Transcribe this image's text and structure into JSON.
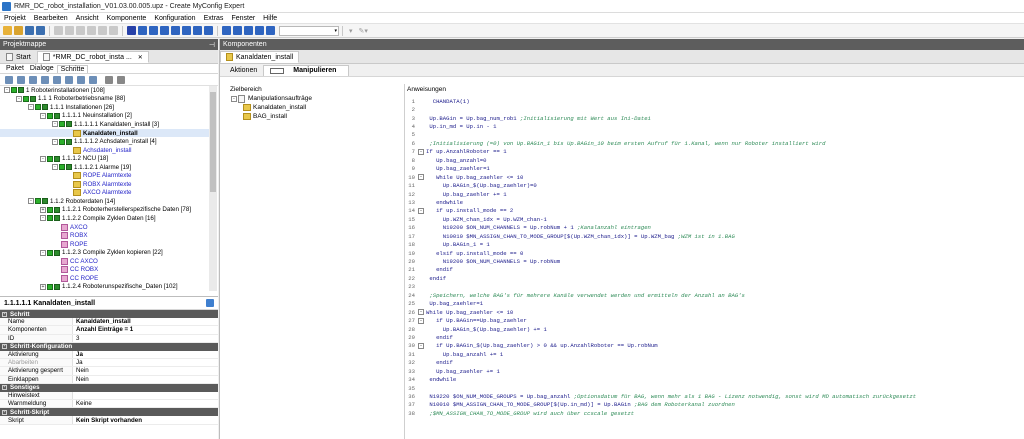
{
  "window": {
    "title": "RMR_DC_robot_installation_V01.03.00.005.upz - Create MyConfig Expert"
  },
  "menu": [
    "Projekt",
    "Bearbeiten",
    "Ansicht",
    "Komponente",
    "Konfiguration",
    "Extras",
    "Fenster",
    "Hilfe"
  ],
  "left": {
    "panel_title": "Projektmappe",
    "tabs": [
      {
        "label": "Start"
      },
      {
        "label": "*RMR_DC_robot_insta ..."
      }
    ],
    "subtabs": [
      "Paket",
      "Dialoge",
      "Schritte"
    ],
    "tree": [
      {
        "d": 0,
        "exp": "-",
        "cb": true,
        "icon": "fol",
        "text": "1 Roboterinstallationen [108]"
      },
      {
        "d": 1,
        "exp": "-",
        "cb": true,
        "icon": "fol",
        "text": "1.1 1 Roboterbetriebsname [88]"
      },
      {
        "d": 2,
        "exp": "-",
        "cb": true,
        "icon": "fol",
        "text": "1.1.1 Installationen [26]"
      },
      {
        "d": 3,
        "exp": "-",
        "cb": true,
        "icon": "fol",
        "text": "1.1.1.1 Neuinstallation [2]"
      },
      {
        "d": 4,
        "exp": "-",
        "cb": true,
        "icon": "fol",
        "text": "1.1.1.1.1 Kanaldaten_install [3]"
      },
      {
        "d": 5,
        "exp": "",
        "cb": false,
        "icon": "yel",
        "text": "Kanaldaten_install",
        "style": "bold",
        "sel": true
      },
      {
        "d": 4,
        "exp": "-",
        "cb": true,
        "icon": "fol",
        "text": "1.1.1.1.2 Achsdaten_install [4]"
      },
      {
        "d": 5,
        "exp": "",
        "cb": false,
        "icon": "yel",
        "text": "Achsdaten_install",
        "style": "blue"
      },
      {
        "d": 3,
        "exp": "-",
        "cb": true,
        "icon": "fol",
        "text": "1.1.1.2 NCU [18]"
      },
      {
        "d": 4,
        "exp": "-",
        "cb": true,
        "icon": "fol",
        "text": "1.1.1.2.1 Alarme [19]"
      },
      {
        "d": 5,
        "exp": "",
        "cb": false,
        "icon": "yel",
        "text": "ROPE Alarmtexte",
        "style": "blue"
      },
      {
        "d": 5,
        "exp": "",
        "cb": false,
        "icon": "yel",
        "text": "ROBX Alarmtexte",
        "style": "blue"
      },
      {
        "d": 5,
        "exp": "",
        "cb": false,
        "icon": "yel",
        "text": "AXCO Alarmtexte",
        "style": "blue"
      },
      {
        "d": 2,
        "exp": "-",
        "cb": true,
        "icon": "fol",
        "text": "1.1.2 Roboterdaten [14]"
      },
      {
        "d": 3,
        "exp": "+",
        "cb": true,
        "icon": "fol",
        "text": "1.1.2.1 Roboterherstellerspezifische Daten [78]"
      },
      {
        "d": 3,
        "exp": "-",
        "cb": true,
        "icon": "fol",
        "text": "1.1.2.2 Compile Zyklen Daten [16]"
      },
      {
        "d": 4,
        "exp": "",
        "cb": false,
        "icon": "pink",
        "text": "AXCO",
        "style": "blue"
      },
      {
        "d": 4,
        "exp": "",
        "cb": false,
        "icon": "pink",
        "text": "ROBX",
        "style": "blue"
      },
      {
        "d": 4,
        "exp": "",
        "cb": false,
        "icon": "pink",
        "text": "ROPE",
        "style": "blue"
      },
      {
        "d": 3,
        "exp": "-",
        "cb": true,
        "icon": "fol",
        "text": "1.1.2.3 Compile Zyklen kopieren [22]"
      },
      {
        "d": 4,
        "exp": "",
        "cb": false,
        "icon": "pink",
        "text": "CC AXCO",
        "style": "blue"
      },
      {
        "d": 4,
        "exp": "",
        "cb": false,
        "icon": "pink",
        "text": "CC ROBX",
        "style": "blue"
      },
      {
        "d": 4,
        "exp": "",
        "cb": false,
        "icon": "pink",
        "text": "CC ROPE",
        "style": "blue"
      },
      {
        "d": 3,
        "exp": "+",
        "cb": true,
        "icon": "fol",
        "text": "1.1.2.4 Roboterunspezifische_Daten [102]"
      }
    ],
    "properties": {
      "title": "1.1.1.1.1 Kanaldaten_install",
      "groups": [
        {
          "name": "Schritt",
          "rows": [
            {
              "k": "Name",
              "v": "Kanaldaten_install",
              "vb": true
            },
            {
              "k": "Komponenten",
              "v": "Anzahl Einträge = 1",
              "vb": true
            },
            {
              "k": "ID",
              "v": "3"
            }
          ]
        },
        {
          "name": "Schritt-Konfiguration",
          "rows": [
            {
              "k": "Aktivierung",
              "v": "Ja",
              "vb": true
            },
            {
              "k": "Abarbeiten",
              "v": "Ja",
              "kg": true
            },
            {
              "k": "Aktivierung gesperrt",
              "v": "Nein"
            },
            {
              "k": "Einklappen",
              "v": "Nein"
            }
          ]
        },
        {
          "name": "Sonstiges",
          "rows": [
            {
              "k": "Hinweistext",
              "v": ""
            },
            {
              "k": "Warnmeldung",
              "v": "Keine"
            }
          ]
        },
        {
          "name": "Schritt-Skript",
          "rows": [
            {
              "k": "Skript",
              "v": "Kein Skript vorhanden",
              "vb": true
            }
          ]
        }
      ]
    }
  },
  "right": {
    "panel_title": "Komponenten",
    "tab": "Kanaldaten_install",
    "subtabs": [
      "Aktionen",
      "Manipulieren"
    ],
    "target_title": "Zielbereich",
    "target_tree": [
      {
        "d": 0,
        "text": "Manipulationsaufträge",
        "icon": "doc"
      },
      {
        "d": 1,
        "text": "Kanaldaten_install",
        "icon": "yel"
      },
      {
        "d": 1,
        "text": "BAG_install",
        "icon": "yel"
      }
    ],
    "instructions_title": "Anweisungen",
    "code": [
      {
        "f": "",
        "t": "  CHANDATA(1)"
      },
      {
        "f": "",
        "t": ""
      },
      {
        "f": "",
        "t": " Up.BAGin = Up.bag_num_rob1 ",
        "c": ";Initialisierung mit Wert aus Ini-Datei"
      },
      {
        "f": "",
        "t": " Up.in_md = Up.in - 1"
      },
      {
        "f": "",
        "t": ""
      },
      {
        "f": "",
        "t": " ",
        "c": ";Initialisierung (=0) von Up.BAGin_1 bis Up.BAGin_10 beim ersten Aufruf für 1.Kanal, wenn nur Roboter installiert wird"
      },
      {
        "f": "-",
        "t": "If up.AnzahlRoboter == 1"
      },
      {
        "f": "",
        "t": "   Up.bag_anzahl=0"
      },
      {
        "f": "",
        "t": "   Up.bag_zaehler=1"
      },
      {
        "f": "-",
        "t": "   While Up.bag_zaehler <= 10"
      },
      {
        "f": "",
        "t": "     Up.BAGin_$(Up.bag_zaehler)=0"
      },
      {
        "f": "",
        "t": "     Up.bag_zaehler += 1"
      },
      {
        "f": "",
        "t": "   endwhile"
      },
      {
        "f": "-",
        "t": "   if up.install_mode == 2"
      },
      {
        "f": "",
        "t": "     Up.WZM_chan_idx = Up.WZM_chan-1"
      },
      {
        "f": "",
        "t": "     N19200 $ON_NUM_CHANNELS = Up.robNum + 1 ",
        "c": ";Kanalanzahl eintragen"
      },
      {
        "f": "",
        "t": "     N10010 $MN_ASSIGN_CHAN_TO_MODE_GROUP[$(Up.WZM_chan_idx)] = Up.WZM_bag ",
        "c": ";WZM ist in 1.BAG"
      },
      {
        "f": "",
        "t": "     Up.BAGin_1 = 1"
      },
      {
        "f": "",
        "t": "   elsif up.install_mode == 0"
      },
      {
        "f": "",
        "t": "     N19200 $ON_NUM_CHANNELS = Up.robNum"
      },
      {
        "f": "",
        "t": "   endif"
      },
      {
        "f": "",
        "t": " endif"
      },
      {
        "f": "",
        "t": ""
      },
      {
        "f": "",
        "t": " ",
        "c": ";Speichern, welche BAG's für mehrere Kanäle verwendet werden und ermitteln der Anzahl an BAG's"
      },
      {
        "f": "",
        "t": " Up.bag_zaehler=1"
      },
      {
        "f": "-",
        "t": "While Up.bag_zaehler <= 10"
      },
      {
        "f": "-",
        "t": "   if Up.BAGin==Up.bag_zaehler"
      },
      {
        "f": "",
        "t": "     Up.BAGin_$(Up.bag_zaehler) += 1"
      },
      {
        "f": "",
        "t": "   endif"
      },
      {
        "f": "-",
        "t": "   if Up.BAGin_$(Up.bag_zaehler) > 0 && up.AnzahlRoboter == Up.robNum"
      },
      {
        "f": "",
        "t": "     Up.bag_anzahl += 1"
      },
      {
        "f": "",
        "t": "   endif"
      },
      {
        "f": "",
        "t": "   Up.bag_zaehler += 1"
      },
      {
        "f": "",
        "t": " endwhile"
      },
      {
        "f": "",
        "t": ""
      },
      {
        "f": "",
        "t": " N19220 $ON_NUM_MODE_GROUPS = Up.bag_anzahl ",
        "c": ";Optionsdatum für BAG, wenn mehr als 1 BAG - Lizenz notwendig, sonst wird MD automatisch zurückgesetzt"
      },
      {
        "f": "",
        "t": " N10010 $MN_ASSIGN_CHAN_TO_MODE_GROUP[$(Up.in_md)] = Up.BAGin ",
        "c": ";BAG dem Roboterkanal zuordnen"
      },
      {
        "f": "",
        "t": " ",
        "c": ";$MN_ASSIGN_CHAN_TO_MODE_GROUP wird auch über ccscale gesetzt"
      }
    ]
  },
  "colors": {
    "accent": "#2bb02b",
    "panel_header": "#5d5d5d",
    "link_blue": "#2525c8"
  }
}
